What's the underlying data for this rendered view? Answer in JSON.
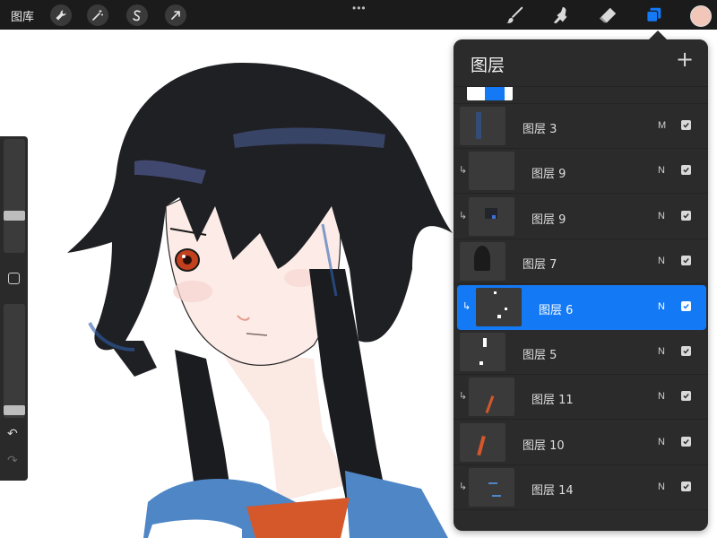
{
  "topbar": {
    "gallery_label": "图库",
    "tools_left": [
      {
        "name": "wrench-icon"
      },
      {
        "name": "magic-wand-icon"
      },
      {
        "name": "selection-icon"
      },
      {
        "name": "transform-arrow-icon"
      }
    ],
    "more_label": "•••",
    "tools_right": [
      {
        "name": "brush-icon"
      },
      {
        "name": "smudge-icon"
      },
      {
        "name": "eraser-icon"
      },
      {
        "name": "layers-icon"
      }
    ],
    "active_color": "#f2c7b9"
  },
  "sidebar": {
    "brush_size_level": 0.31,
    "opacity_level": 0.03,
    "undo_label": "↶",
    "redo_label": "↷"
  },
  "layers_panel": {
    "title": "图层",
    "add_label": "+",
    "layers": [
      {
        "name": "图层 3",
        "blend": "M",
        "visible": true,
        "clipped": false,
        "selected": false
      },
      {
        "name": "图层 9",
        "blend": "N",
        "visible": true,
        "clipped": true,
        "selected": false
      },
      {
        "name": "图层 9",
        "blend": "N",
        "visible": true,
        "clipped": true,
        "selected": false
      },
      {
        "name": "图层 7",
        "blend": "N",
        "visible": true,
        "clipped": false,
        "selected": false
      },
      {
        "name": "图层 6",
        "blend": "N",
        "visible": true,
        "clipped": true,
        "selected": true
      },
      {
        "name": "图层 5",
        "blend": "N",
        "visible": true,
        "clipped": false,
        "selected": false
      },
      {
        "name": "图层 11",
        "blend": "N",
        "visible": true,
        "clipped": true,
        "selected": false
      },
      {
        "name": "图层 10",
        "blend": "N",
        "visible": true,
        "clipped": false,
        "selected": false
      },
      {
        "name": "图层 14",
        "blend": "N",
        "visible": true,
        "clipped": true,
        "selected": false
      }
    ]
  },
  "colors": {
    "accent": "#1479f5",
    "panel_bg": "#2b2b2b",
    "topbar_bg": "#1b1b1b"
  }
}
